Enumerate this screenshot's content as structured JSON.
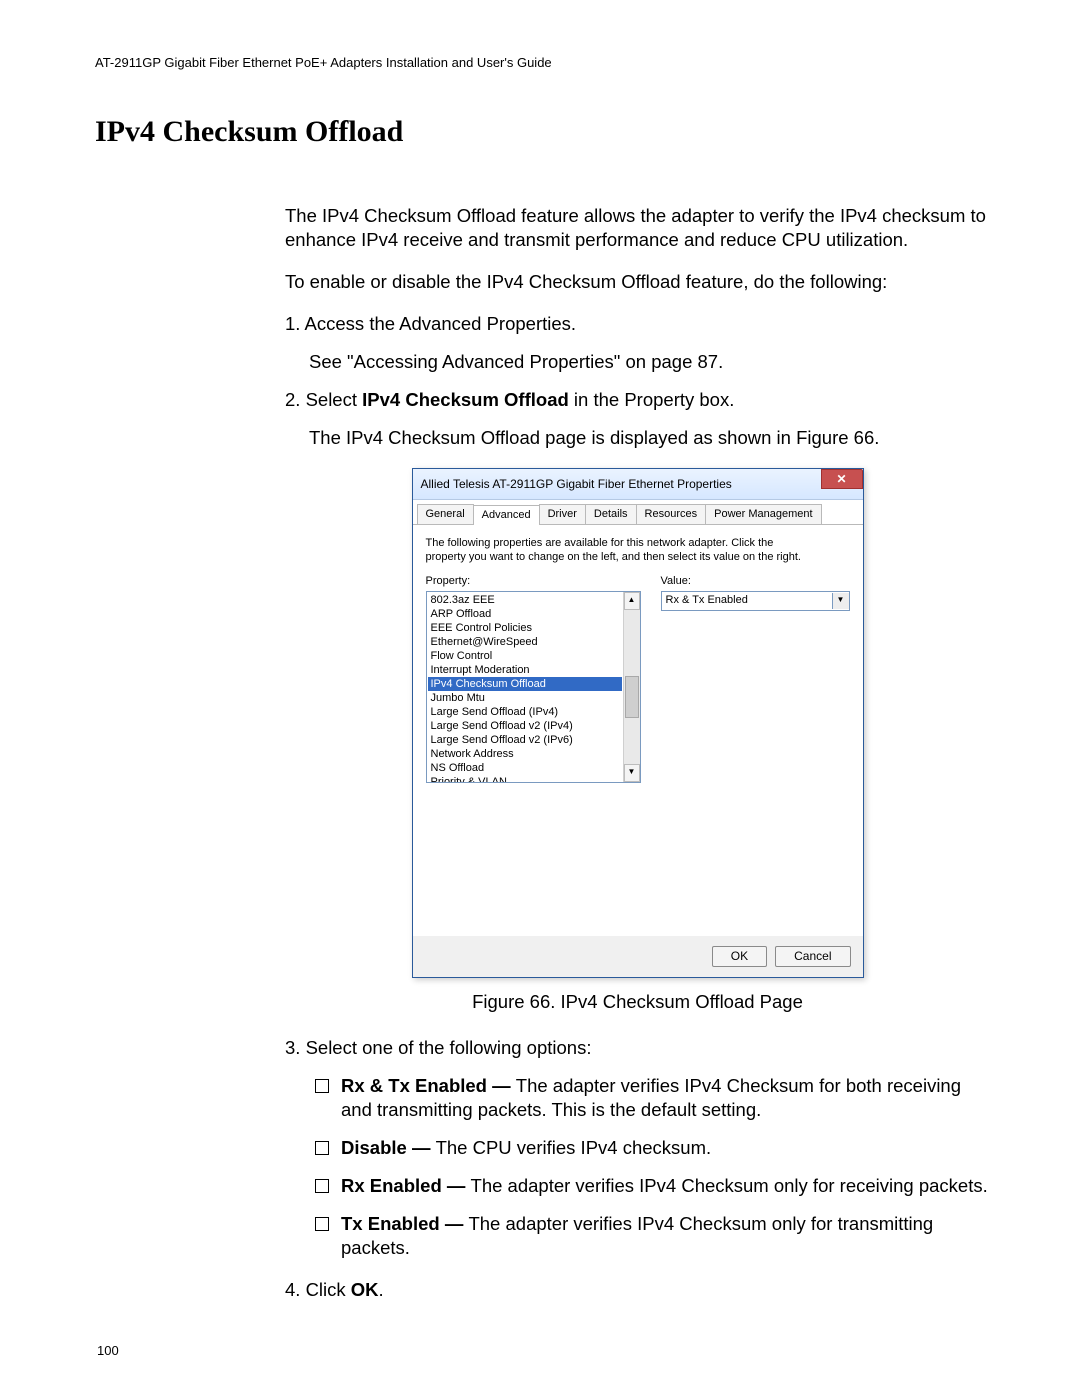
{
  "doc": {
    "header": "AT-2911GP Gigabit Fiber Ethernet PoE+ Adapters Installation and User's Guide",
    "title": "IPv4 Checksum Offload",
    "p1": "The IPv4 Checksum Offload feature allows the adapter to verify the IPv4 checksum to enhance IPv4 receive and transmit performance and reduce CPU utilization.",
    "p2": "To enable or disable the IPv4 Checksum Offload feature, do the following:",
    "steps": {
      "s1a": "1.  Access the Advanced Properties.",
      "s1b": "See \"Accessing Advanced Properties\" on page 87.",
      "s2a_pre": "2.  Select ",
      "s2a_bold": "IPv4 Checksum Offload",
      "s2a_post": " in the Property box.",
      "s2b": "The IPv4 Checksum Offload page is displayed as shown in Figure 66.",
      "s3": "3.  Select one of the following options:",
      "s4_pre": "4.  Click ",
      "s4_bold": "OK",
      "s4_post": "."
    },
    "options": {
      "o1_b": "Rx & Tx Enabled — ",
      "o1_t": "The adapter verifies IPv4 Checksum for both receiving and transmitting packets. This is the default setting.",
      "o2_b": "Disable — ",
      "o2_t": "The CPU verifies IPv4 checksum.",
      "o3_b": "Rx Enabled — ",
      "o3_t": "The adapter verifies IPv4 Checksum only for receiving packets.",
      "o4_b": "Tx Enabled — ",
      "o4_t": "The adapter verifies IPv4 Checksum only for transmitting packets."
    },
    "figcaption": "Figure 66. IPv4 Checksum Offload Page",
    "pagenum": "100"
  },
  "dialog": {
    "title": "Allied Telesis AT-2911GP Gigabit Fiber Ethernet Properties",
    "tabs": [
      "General",
      "Advanced",
      "Driver",
      "Details",
      "Resources",
      "Power Management"
    ],
    "hint": "The following properties are available for this network adapter. Click the property you want to change on the left, and then select its value on the right.",
    "property_label": "Property:",
    "value_label": "Value:",
    "properties": [
      "802.3az EEE",
      "ARP Offload",
      "EEE Control Policies",
      "Ethernet@WireSpeed",
      "Flow Control",
      "Interrupt Moderation",
      "IPv4 Checksum Offload",
      "Jumbo Mtu",
      "Large Send Offload (IPv4)",
      "Large Send Offload v2 (IPv4)",
      "Large Send Offload v2 (IPv6)",
      "Network Address",
      "NS Offload",
      "Priority & VLAN"
    ],
    "selected_index": 6,
    "value": "Rx & Tx Enabled",
    "ok": "OK",
    "cancel": "Cancel"
  }
}
